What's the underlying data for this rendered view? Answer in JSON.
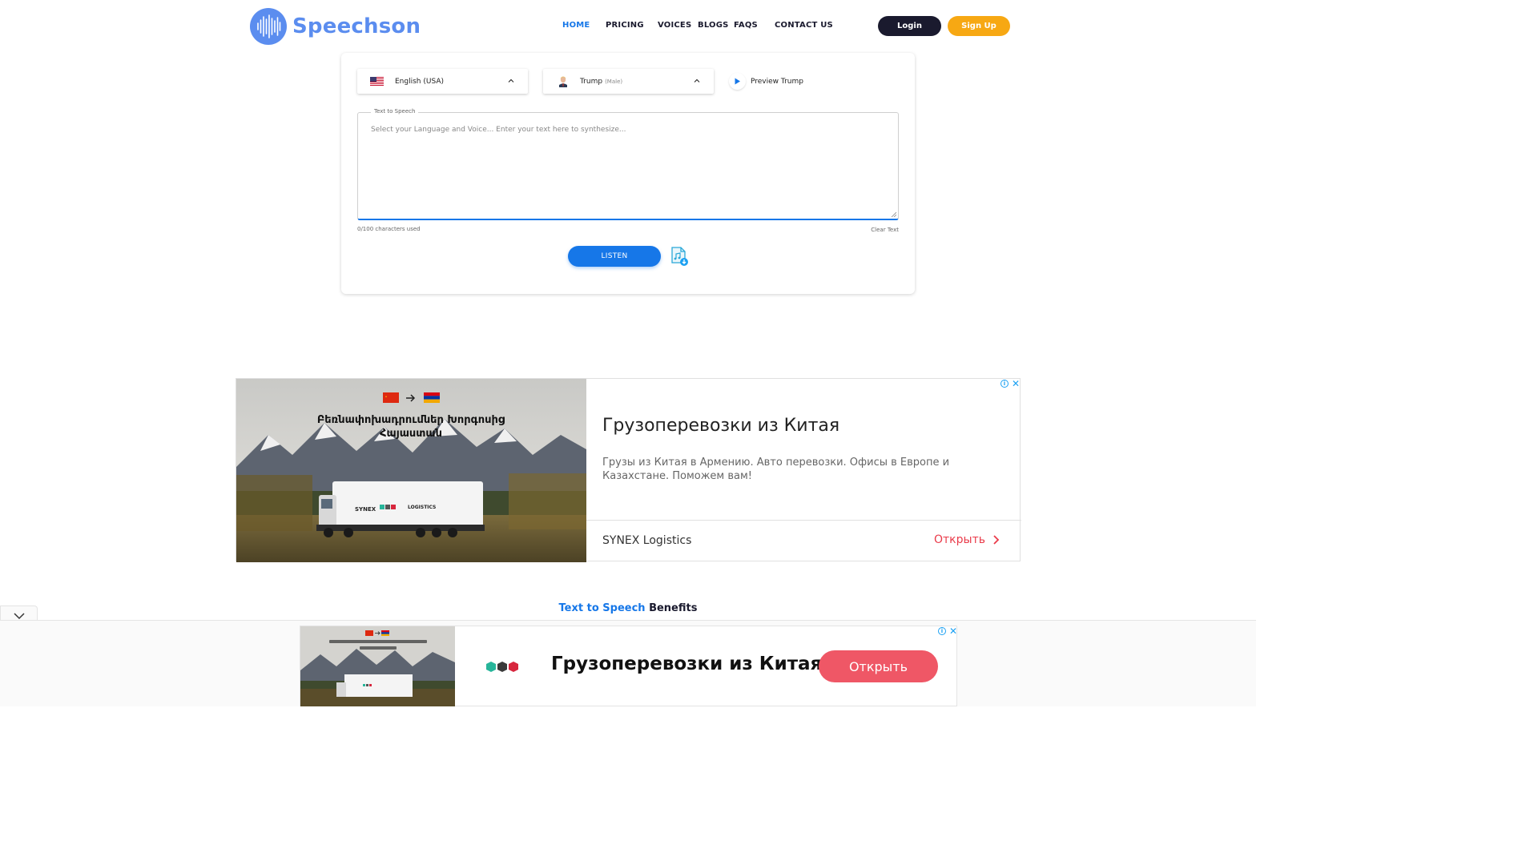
{
  "header": {
    "logo_text": "Speechson",
    "nav": [
      {
        "label": "HOME",
        "active": true
      },
      {
        "label": "PRICING",
        "active": false
      },
      {
        "label": "VOICES",
        "active": false
      },
      {
        "label": "BLOGS",
        "active": false
      },
      {
        "label": "FAQS",
        "active": false
      },
      {
        "label": "CONTACT US",
        "active": false
      }
    ],
    "login_label": "Login",
    "signup_label": "Sign Up"
  },
  "tts": {
    "language": "English (USA)",
    "voice_name": "Trump",
    "voice_gender": "(Male)",
    "preview_label": "Preview Trump",
    "legend": "Text to Speech",
    "placeholder": "Select your Language and Voice... Enter your text here to synthesize...",
    "char_count": "0/100 characters used",
    "clear_label": "Clear Text",
    "listen_label": "LISTEN"
  },
  "ad_top": {
    "image_caption_1": "Բեռնափոխադրումներ Խորգոսից",
    "image_caption_2": "Հայաստան",
    "truck_brand": "SYNEX",
    "truck_brand_2": "LOGISTICS",
    "title": "Грузоперевозки из Китая",
    "description": "Грузы из Китая в Армению. Авто перевозки. Офисы в Европе и Казахстане. Поможем вам!",
    "advertiser": "SYNEX Logistics",
    "cta": "Открыть"
  },
  "benefits": {
    "highlight": "Text to Speech",
    "rest": " Benefits"
  },
  "ad_bottom": {
    "title": "Грузоперевозки из Китая",
    "cta": "Открыть"
  },
  "colors": {
    "brand": "#5b8def",
    "accent": "#1677e8",
    "signup": "#f7a813",
    "ad_cta": "#ea3b4a"
  }
}
